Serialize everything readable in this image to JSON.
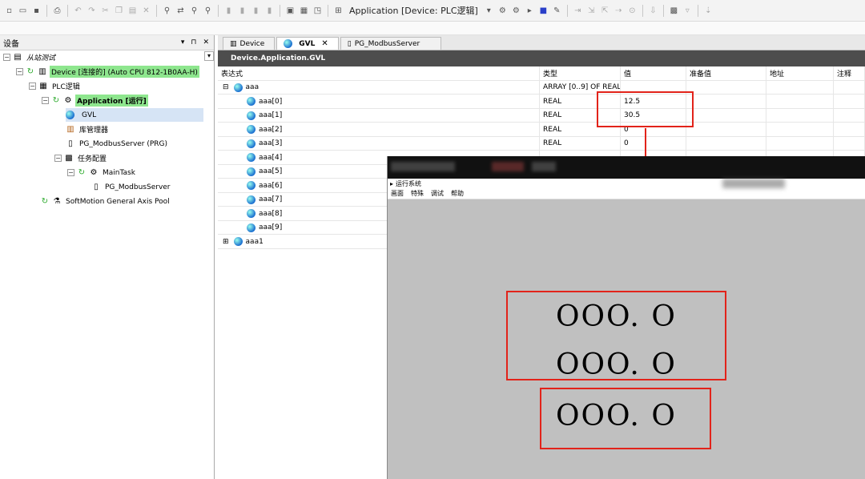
{
  "toolbar": {
    "app_selector": "Application [Device: PLC逻辑]"
  },
  "devices_panel": {
    "title": "设备",
    "controls": [
      "▾",
      "⊓",
      "✕"
    ],
    "tree": [
      {
        "label": "从站测试",
        "icon": "project-icon"
      },
      {
        "label": "Device [连接的] (Auto CPU 812-1B0AA-H)",
        "icon": "device-icon"
      },
      {
        "label": "PLC逻辑",
        "icon": "plc-logic-icon"
      },
      {
        "label": "Application [运行]",
        "icon": "application-gear-icon"
      },
      {
        "label": "GVL",
        "icon": "gvl-globe-icon"
      },
      {
        "label": "库管理器",
        "icon": "library-icon"
      },
      {
        "label": "PG_ModbusServer (PRG)",
        "icon": "program-icon"
      },
      {
        "label": "任务配置",
        "icon": "task-config-icon"
      },
      {
        "label": "MainTask",
        "icon": "task-icon"
      },
      {
        "label": "PG_ModbusServer",
        "icon": "program-call-icon"
      },
      {
        "label": "SoftMotion General Axis Pool",
        "icon": "axis-pool-icon"
      }
    ]
  },
  "editor": {
    "tabs": [
      {
        "label": "Device",
        "icon": "device-tab-icon"
      },
      {
        "label": "GVL",
        "icon": "gvl-tab-icon",
        "close": "✕"
      },
      {
        "label": "PG_ModbusServer",
        "icon": "program-tab-icon"
      }
    ],
    "title": "Device.Application.GVL",
    "columns": [
      "表达式",
      "类型",
      "值",
      "准备值",
      "地址",
      "注释"
    ],
    "rows": [
      {
        "expr": "aaa",
        "type": "ARRAY [0..9] OF REAL",
        "value": "",
        "expander": "⊟"
      },
      {
        "expr": "aaa[0]",
        "type": "REAL",
        "value": "12.5"
      },
      {
        "expr": "aaa[1]",
        "type": "REAL",
        "value": "30.5"
      },
      {
        "expr": "aaa[2]",
        "type": "REAL",
        "value": "0"
      },
      {
        "expr": "aaa[3]",
        "type": "REAL",
        "value": "0"
      },
      {
        "expr": "aaa[4]",
        "type": "",
        "value": ""
      },
      {
        "expr": "aaa[5]",
        "type": "",
        "value": ""
      },
      {
        "expr": "aaa[6]",
        "type": "",
        "value": ""
      },
      {
        "expr": "aaa[7]",
        "type": "",
        "value": ""
      },
      {
        "expr": "aaa[8]",
        "type": "",
        "value": ""
      },
      {
        "expr": "aaa[9]",
        "type": "",
        "value": ""
      },
      {
        "expr": "aaa1",
        "type": "",
        "value": "",
        "expander": "⊞"
      }
    ]
  },
  "runtime_window": {
    "caption": "运行系统",
    "menu": [
      "画面",
      "特殊",
      "调试",
      "帮助"
    ],
    "displays": [
      "OOO. O",
      "OOO. O",
      "OOO. O"
    ]
  },
  "colors": {
    "highlight_box": "#e2231a",
    "running_green": "#8ee68e",
    "gvl_header": "#4d4d4d"
  }
}
